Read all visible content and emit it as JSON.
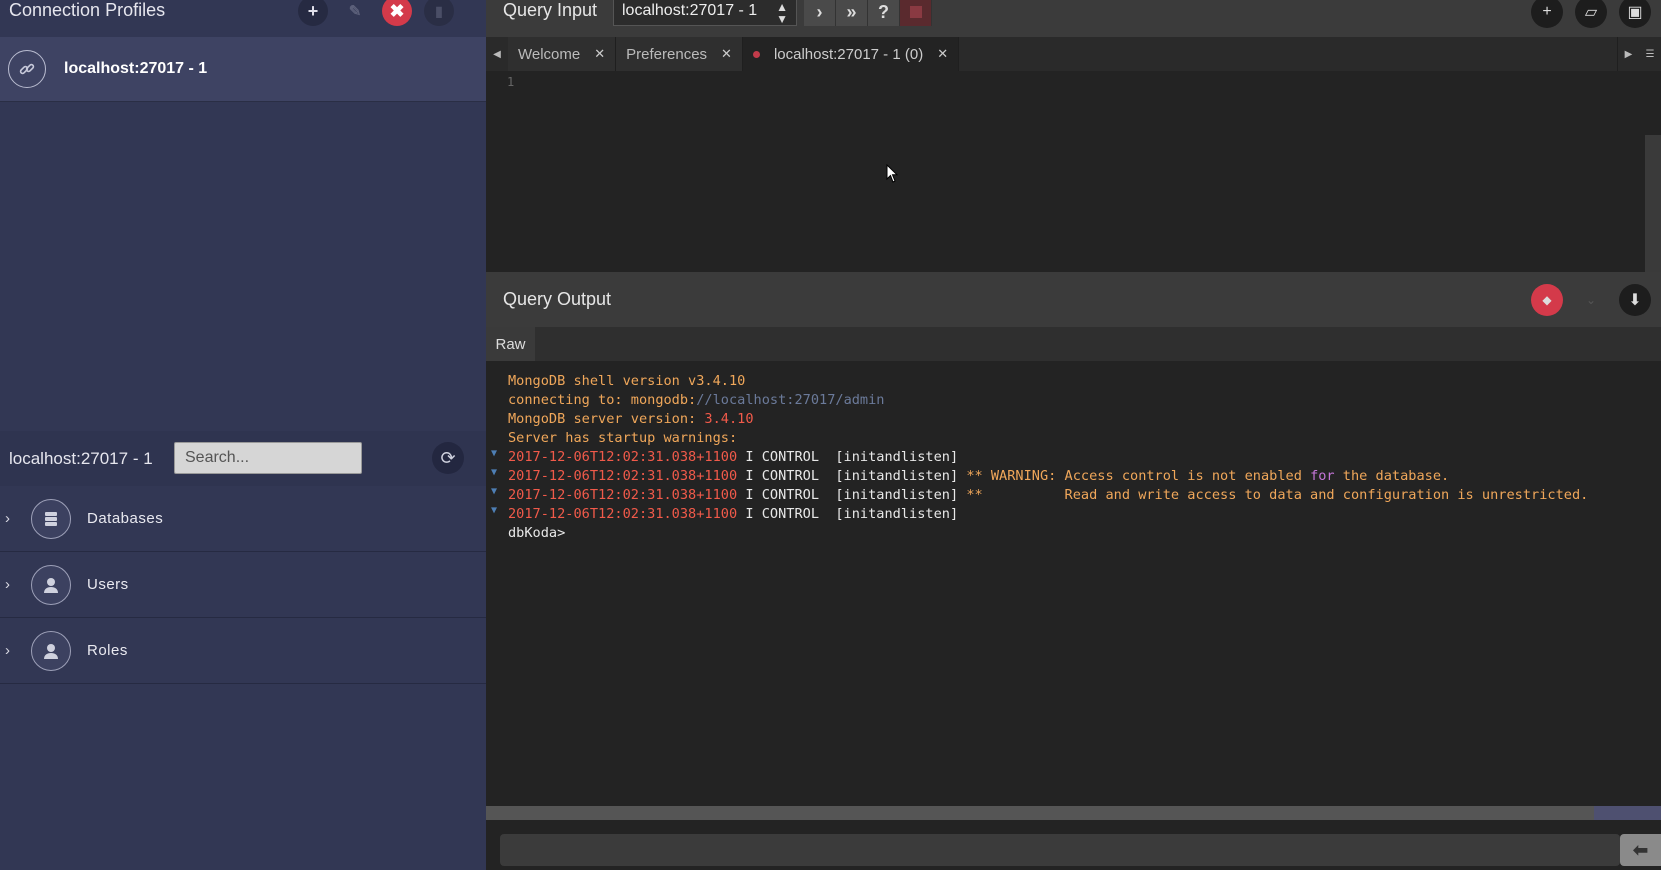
{
  "left_panel": {
    "title": "Connection Profiles",
    "profile_label": "localhost:27017 - 1",
    "tree_title": "localhost:27017 - 1",
    "search_placeholder": "Search...",
    "tree_items": [
      {
        "label": "Databases",
        "icon": "database-icon"
      },
      {
        "label": "Users",
        "icon": "user-icon"
      },
      {
        "label": "Roles",
        "icon": "role-icon"
      }
    ]
  },
  "query_input": {
    "title": "Query Input",
    "connection_selected": "localhost:27017 - 1",
    "help_label": "?"
  },
  "tabs": [
    {
      "label": "Welcome"
    },
    {
      "label": "Preferences"
    },
    {
      "label": "localhost:27017 - 1 (0)"
    }
  ],
  "editor": {
    "line_number": "1"
  },
  "query_output": {
    "title": "Query Output",
    "raw_tab": "Raw",
    "lines": {
      "l1": "MongoDB shell version v3.4.10",
      "l2a": "connecting to: mongodb:",
      "l2b": "//localhost:27017/admin",
      "l3a": "MongoDB server version: ",
      "l3b": "3.4.10",
      "l4": "Server has startup warnings:",
      "ts": "2017-12-06T12:02:31.038+1100",
      "ctl": " I CONTROL  [initandlisten]",
      "w1a": " ** WARNING: Access control is not enabled ",
      "w1kw": "for",
      "w1b": " the database.",
      "w2": " **          Read and write access to data and configuration is unrestricted.",
      "prompt": "dbKoda>"
    }
  },
  "colors": {
    "accent_red": "#c23b4a",
    "left_bg": "#323754",
    "editor_bg": "#232323"
  }
}
